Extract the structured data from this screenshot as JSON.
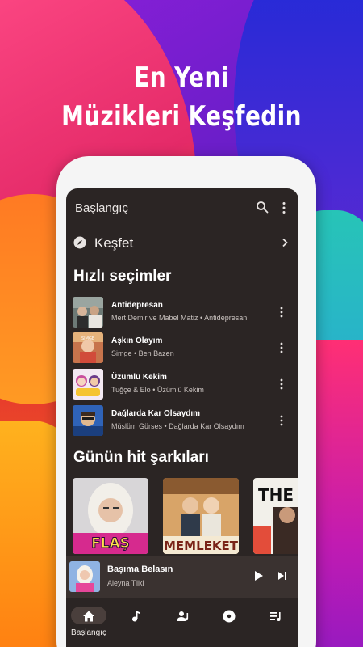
{
  "promo": {
    "headline_line1": "En Yeni",
    "headline_line2": "Müzikleri Keşfedin"
  },
  "app": {
    "title": "Başlangıç",
    "icons": {
      "search": "search-icon",
      "more": "more-vert-icon"
    }
  },
  "explore": {
    "label": "Keşfet",
    "icon": "compass-icon"
  },
  "quick_picks": {
    "title": "Hızlı seçimler",
    "items": [
      {
        "title": "Antidepresan",
        "meta": "Mert Demir ve Mabel Matiz • Antidepresan"
      },
      {
        "title": "Aşkın Olayım",
        "meta": "Simge • Ben Bazen"
      },
      {
        "title": "Üzümlü Kekim",
        "meta": "Tuğçe & Elo • Üzümlü Kekim"
      },
      {
        "title": "Dağlarda Kar Olsaydım",
        "meta": "Müslüm Gürses • Dağlarda Kar Olsaydım"
      }
    ]
  },
  "daily_hits": {
    "title": "Günün hit şarkıları",
    "covers": [
      {
        "label": "FLAŞ"
      },
      {
        "label": "MEMLEKET"
      },
      {
        "label": "THE HIT"
      }
    ]
  },
  "now_playing": {
    "title": "Başıma Belasın",
    "artist": "Aleyna Tilki"
  },
  "bottom_nav": {
    "items": [
      {
        "label": "Başlangıç",
        "icon": "home-icon",
        "active": true
      },
      {
        "label": "",
        "icon": "music-note-icon",
        "active": false
      },
      {
        "label": "",
        "icon": "artist-icon",
        "active": false
      },
      {
        "label": "",
        "icon": "album-disc-icon",
        "active": false
      },
      {
        "label": "",
        "icon": "playlist-icon",
        "active": false
      }
    ]
  },
  "colors": {
    "screen_bg": "#2b2524",
    "player_bg": "#3a3230",
    "nav_pill": "#4a3f3c",
    "text_primary": "#ffffff",
    "text_secondary": "#c9c2bf"
  }
}
